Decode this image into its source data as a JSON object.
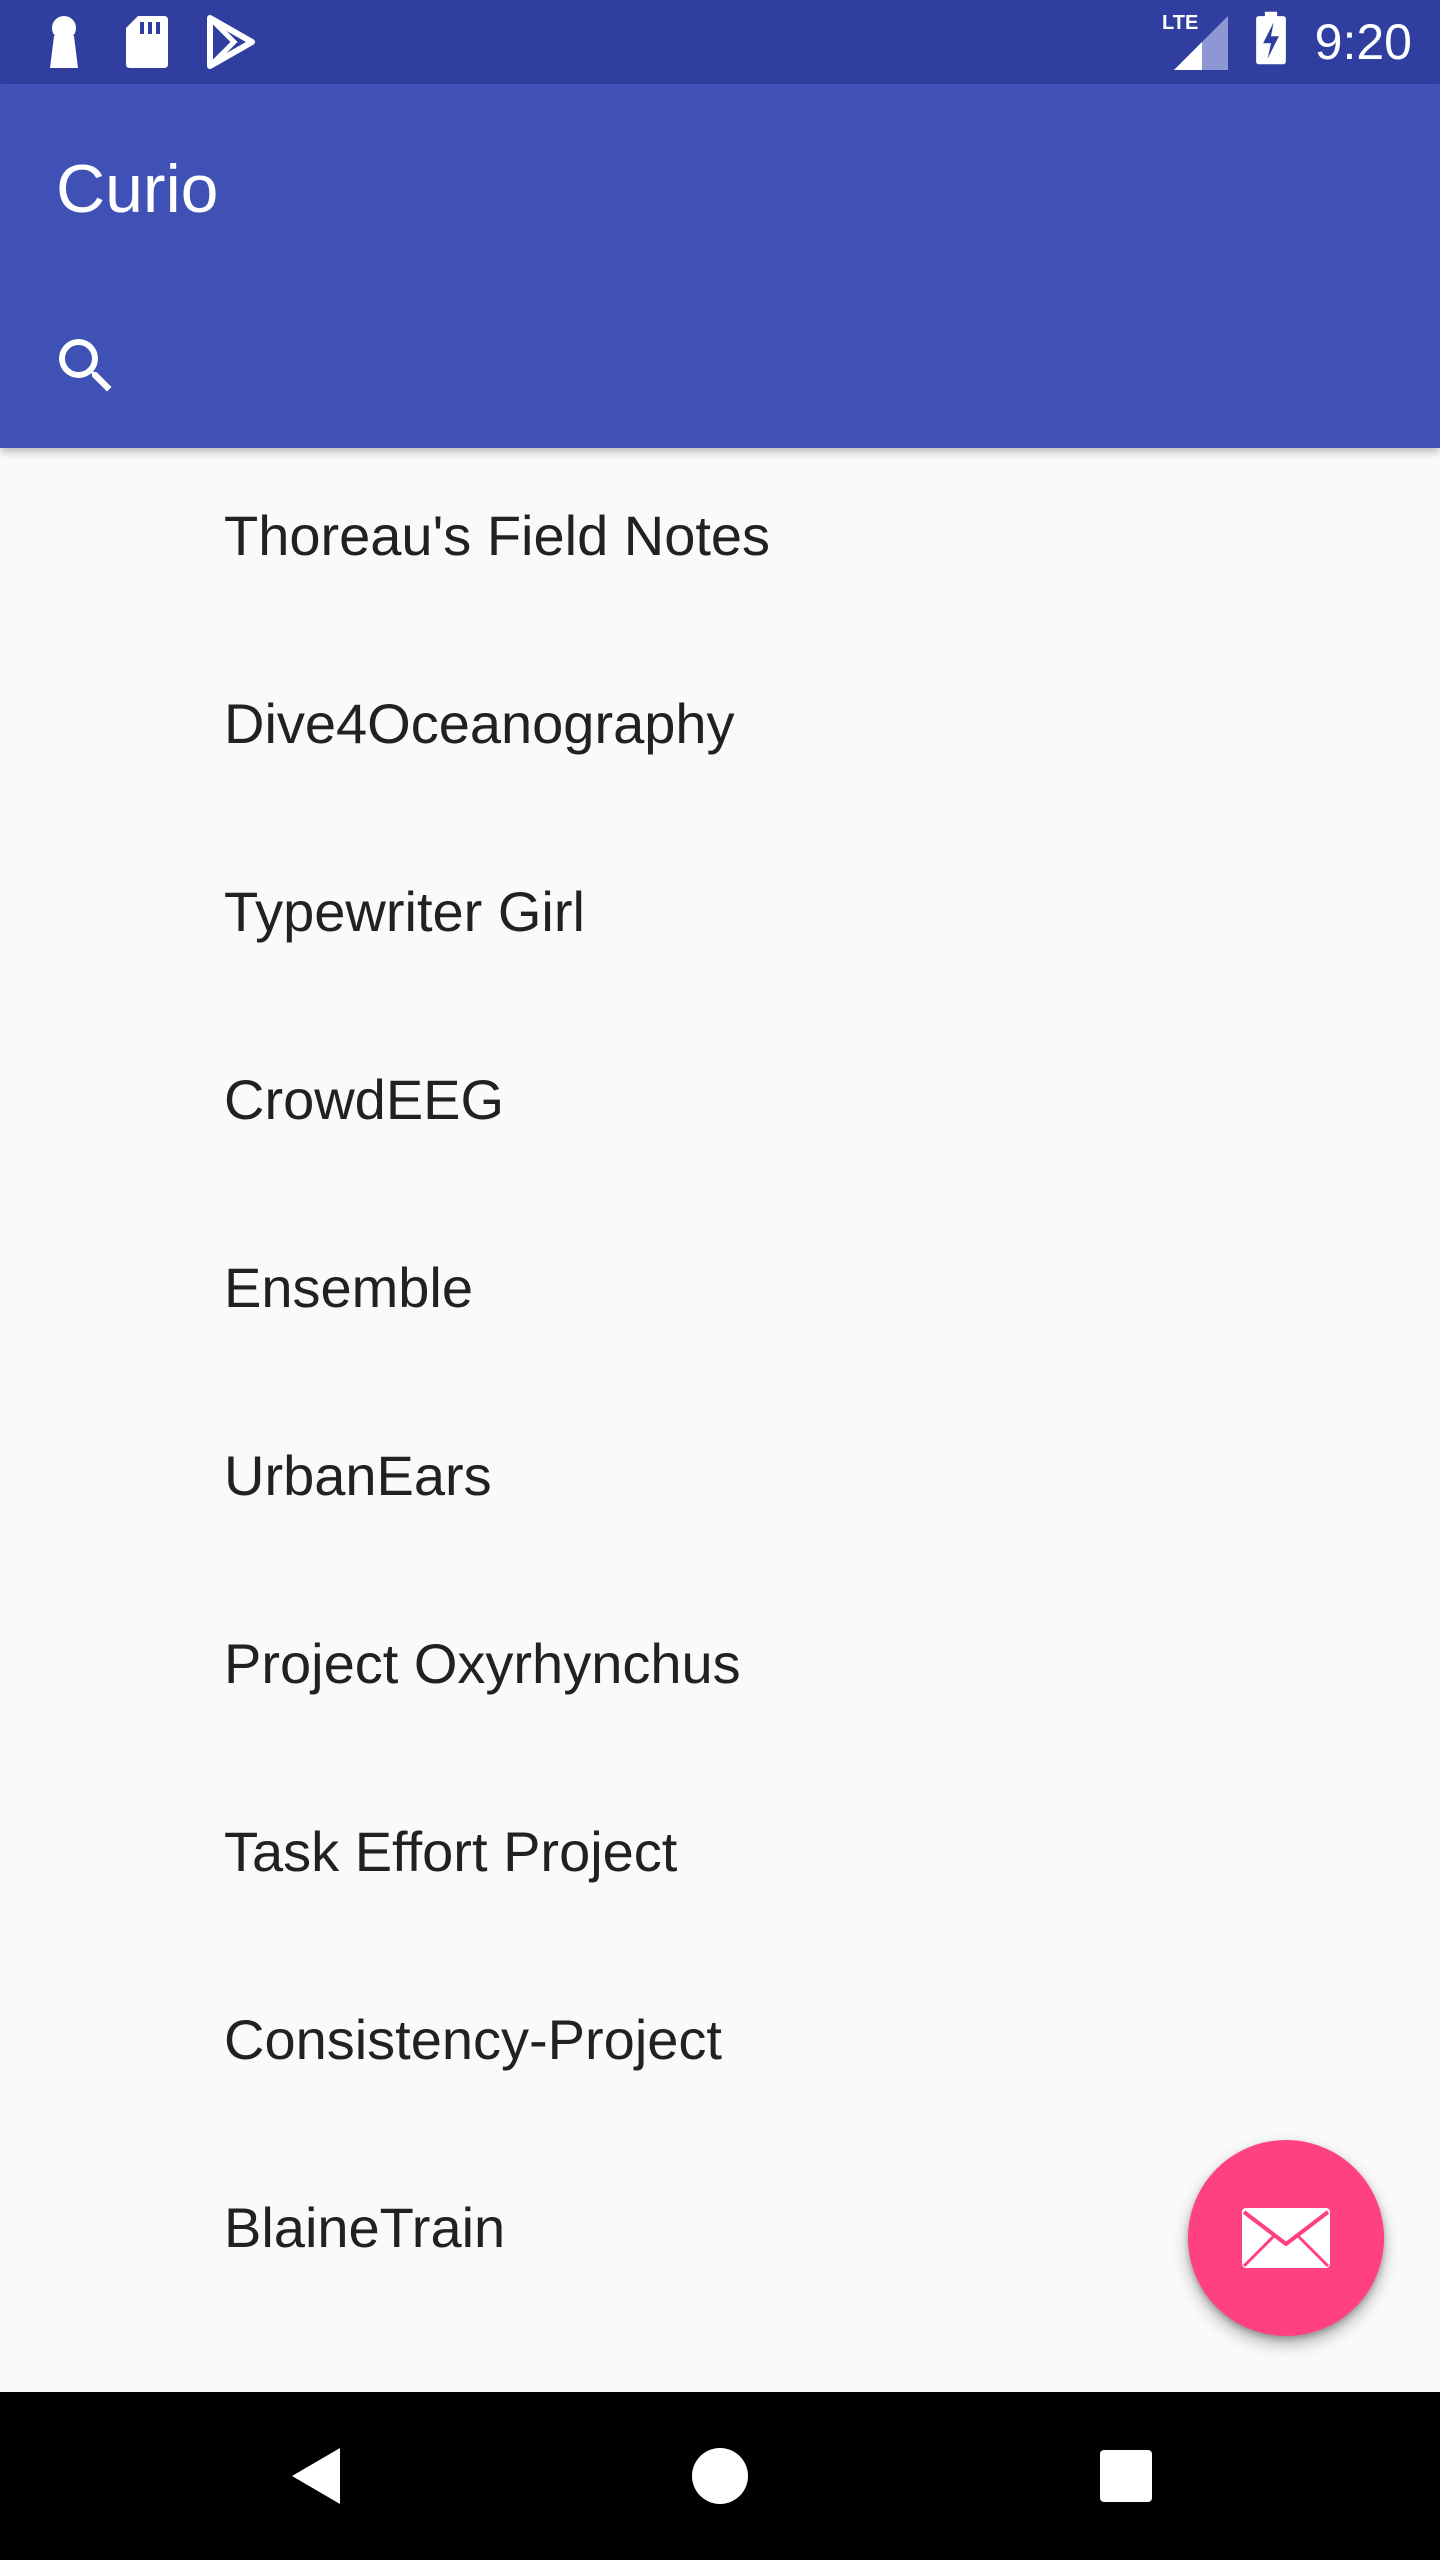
{
  "status_bar": {
    "time": "9:20",
    "network": "LTE",
    "icons": [
      "keyhole-icon",
      "sd-card-icon",
      "play-store-icon",
      "lte-signal-icon",
      "battery-charging-icon"
    ]
  },
  "app_bar": {
    "title": "Curio",
    "search_icon": "search-icon"
  },
  "projects": [
    {
      "label": "Thoreau's Field Notes"
    },
    {
      "label": "Dive4Oceanography"
    },
    {
      "label": "Typewriter Girl"
    },
    {
      "label": "CrowdEEG"
    },
    {
      "label": "Ensemble"
    },
    {
      "label": "UrbanEars"
    },
    {
      "label": "Project Oxyrhynchus"
    },
    {
      "label": "Task Effort Project"
    },
    {
      "label": "Consistency-Project"
    },
    {
      "label": "BlaineTrain"
    }
  ],
  "fab": {
    "icon": "mail-icon"
  },
  "colors": {
    "status_bar": "#303f9f",
    "primary": "#3f51b5",
    "accent": "#ff4081",
    "background": "#fafafa",
    "text": "#212121"
  },
  "nav_bar": {
    "icons": [
      "back-icon",
      "home-icon",
      "recents-icon"
    ]
  }
}
